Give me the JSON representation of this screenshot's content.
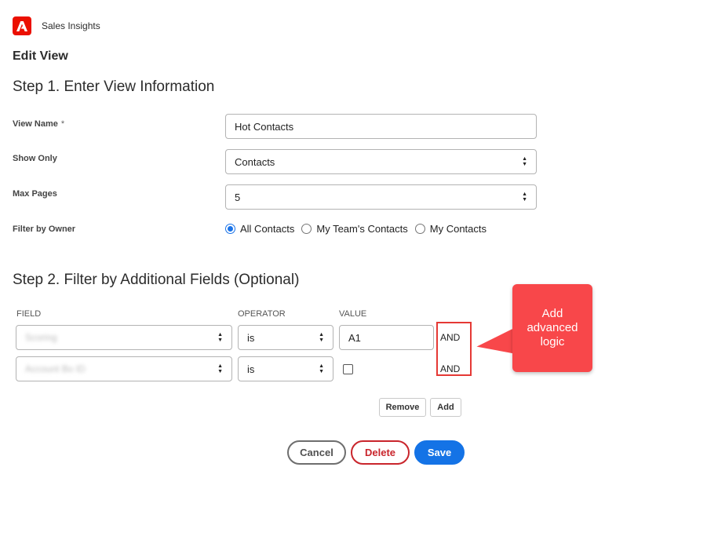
{
  "app": {
    "title": "Sales Insights",
    "brand_color": "#eb1000",
    "logo_icon": "adobe-logo-icon"
  },
  "page_title": "Edit View",
  "step1": {
    "title": "Step 1. Enter View Information",
    "view_name_label": "View Name",
    "required_marker": "*",
    "view_name_value": "Hot Contacts",
    "show_only_label": "Show Only",
    "show_only_value": "Contacts",
    "max_pages_label": "Max Pages",
    "max_pages_value": "5",
    "filter_owner_label": "Filter by Owner",
    "owner_options": [
      "All Contacts",
      "My Team's Contacts",
      "My Contacts"
    ],
    "owner_selected": "All Contacts"
  },
  "step2": {
    "title": "Step 2. Filter by Additional Fields (Optional)",
    "headers": {
      "field": "FIELD",
      "operator": "OPERATOR",
      "value": "VALUE"
    },
    "rows": [
      {
        "field": "Scoring",
        "operator": "is",
        "value": "A1",
        "logic": "AND"
      },
      {
        "field": "Account Bo ID",
        "operator": "is",
        "value": "",
        "logic": "AND"
      }
    ],
    "remove_label": "Remove",
    "add_label": "Add"
  },
  "callout": {
    "text": "Add advanced logic",
    "color": "#f8474a"
  },
  "actions": {
    "cancel": "Cancel",
    "delete": "Delete",
    "save": "Save"
  },
  "colors": {
    "accent": "#1473e6",
    "danger": "#c9252c",
    "highlight": "#e53935"
  }
}
